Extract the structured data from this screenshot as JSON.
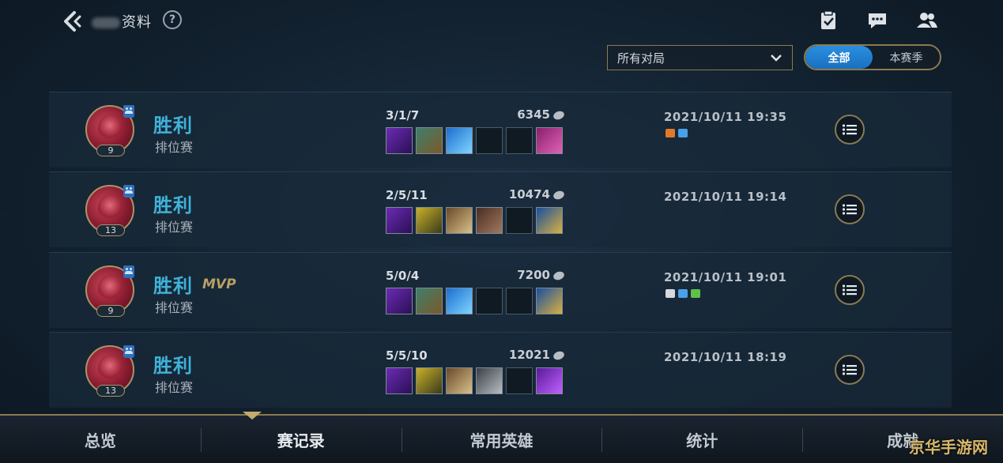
{
  "header": {
    "title": "资料",
    "help": "?"
  },
  "filters": {
    "match_type": "所有对局",
    "segments": [
      "全部",
      "本赛季"
    ],
    "active_segment": 0
  },
  "matches": [
    {
      "result": "胜利",
      "mvp": "",
      "mode": "排位赛",
      "level": "9",
      "kda": "3/1/7",
      "gold": "6345",
      "datetime": "2021/10/11 19:35",
      "items": [
        "purple",
        "green",
        "blue",
        "",
        "",
        "pink"
      ],
      "tags": [
        "#e07a2a",
        "#4aa0e6"
      ]
    },
    {
      "result": "胜利",
      "mvp": "",
      "mode": "排位赛",
      "level": "13",
      "kda": "2/5/11",
      "gold": "10474",
      "datetime": "2021/10/11 19:14",
      "items": [
        "purple",
        "yellow",
        "tan",
        "brown",
        "",
        "gold"
      ],
      "tags": []
    },
    {
      "result": "胜利",
      "mvp": "MVP",
      "mode": "排位赛",
      "level": "9",
      "kda": "5/0/4",
      "gold": "7200",
      "datetime": "2021/10/11 19:01",
      "items": [
        "purple",
        "green",
        "blue",
        "",
        "",
        "gold"
      ],
      "tags": [
        "#d8d8e0",
        "#4aa0e6",
        "#5ec24a"
      ]
    },
    {
      "result": "胜利",
      "mvp": "",
      "mode": "排位赛",
      "level": "13",
      "kda": "5/5/10",
      "gold": "12021",
      "datetime": "2021/10/11 18:19",
      "items": [
        "purple",
        "yellow",
        "tan",
        "gray",
        "",
        "violet"
      ],
      "tags": []
    }
  ],
  "nav": {
    "items": [
      "总览",
      "赛记录",
      "常用英雄",
      "统计",
      "成就"
    ],
    "active": 1
  },
  "watermark": "京华手游网",
  "colors": {
    "accent_gold": "#8c7a4f",
    "win_blue": "#3fb2d9",
    "segment_active": "#2a8fe0"
  },
  "icons": [
    "back-arrow-icon",
    "help-icon",
    "clipboard-check-icon",
    "chat-icon",
    "friends-icon",
    "chevron-down-icon",
    "list-icon",
    "gold-coin-icon"
  ]
}
